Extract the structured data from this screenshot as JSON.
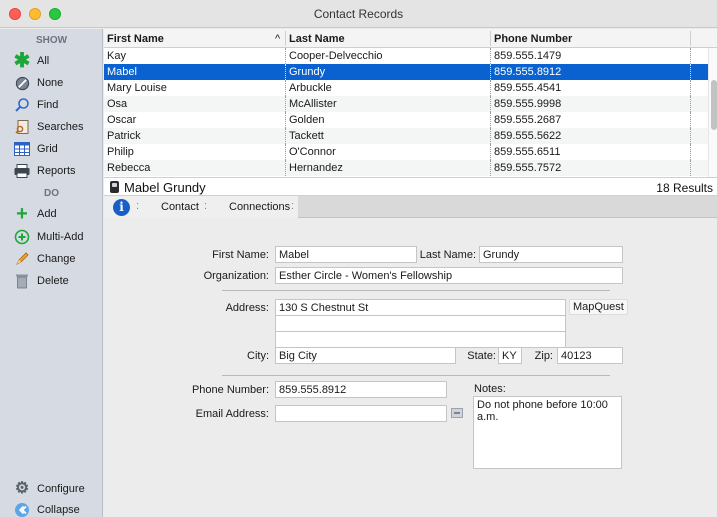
{
  "window": {
    "title": "Contact Records"
  },
  "sidebar": {
    "show_label": "SHOW",
    "do_label": "DO",
    "show_items": [
      {
        "label": "All",
        "icon": "asterisk-icon"
      },
      {
        "label": "None",
        "icon": "no-entry-icon"
      },
      {
        "label": "Find",
        "icon": "search-icon"
      },
      {
        "label": "Searches",
        "icon": "saved-searches-icon"
      },
      {
        "label": "Grid",
        "icon": "grid-icon"
      },
      {
        "label": "Reports",
        "icon": "printer-icon"
      }
    ],
    "do_items": [
      {
        "label": "Add",
        "icon": "plus-icon"
      },
      {
        "label": "Multi-Add",
        "icon": "multi-add-icon"
      },
      {
        "label": "Change",
        "icon": "pencil-icon"
      },
      {
        "label": "Delete",
        "icon": "trash-icon"
      }
    ],
    "configure_label": "Configure",
    "collapse_label": "Collapse"
  },
  "grid": {
    "columns": [
      "First Name",
      "Last Name",
      "Phone Number"
    ],
    "sort_indicator": "^",
    "rows": [
      {
        "first": "Kay",
        "last": "Cooper-Delvecchio",
        "phone": "859.555.1479"
      },
      {
        "first": "Mabel",
        "last": "Grundy",
        "phone": "859.555.8912",
        "selected": true
      },
      {
        "first": "Mary Louise",
        "last": "Arbuckle",
        "phone": "859.555.4541"
      },
      {
        "first": "Osa",
        "last": "McAllister",
        "phone": "859.555.9998"
      },
      {
        "first": "Oscar",
        "last": "Golden",
        "phone": "859.555.2687"
      },
      {
        "first": "Patrick",
        "last": "Tackett",
        "phone": "859.555.5622"
      },
      {
        "first": "Philip",
        "last": "O'Connor",
        "phone": "859.555.6511"
      },
      {
        "first": "Rebecca",
        "last": "Hernandez",
        "phone": "859.555.7572"
      }
    ]
  },
  "detail": {
    "name": "Mabel Grundy",
    "results": "18 Results",
    "tabs": {
      "contact": "Contact",
      "connections": "Connections",
      "info_glyph": "i",
      "separator": ":"
    }
  },
  "form": {
    "first_name": {
      "label": "First Name:",
      "value": "Mabel"
    },
    "last_name": {
      "label": "Last Name:",
      "value": "Grundy"
    },
    "organization": {
      "label": "Organization:",
      "value": "Esther Circle - Women's Fellowship"
    },
    "address": {
      "label": "Address:",
      "line1": "130 S Chestnut St",
      "line2": "",
      "line3": ""
    },
    "mapquest": "MapQuest",
    "city": {
      "label": "City:",
      "value": "Big City"
    },
    "state": {
      "label": "State:",
      "value": "KY"
    },
    "zip": {
      "label": "Zip:",
      "value": "40123"
    },
    "phone": {
      "label": "Phone Number:",
      "value": "859.555.8912"
    },
    "email": {
      "label": "Email Address:",
      "value": ""
    },
    "notes": {
      "label": "Notes:",
      "value": "Do not phone before 10:00 a.m."
    }
  },
  "colors": {
    "selection": "#0962cf",
    "sidebar_bg": "#d6dae2",
    "info_blue": "#1760c9"
  }
}
